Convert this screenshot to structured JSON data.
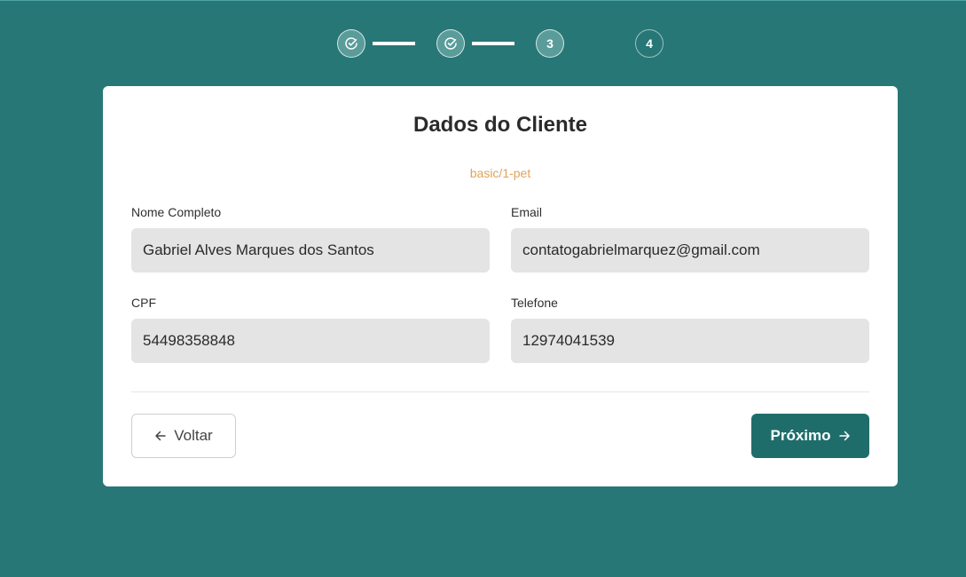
{
  "stepper": {
    "steps": [
      {
        "label": "",
        "state": "done",
        "icon": "check-circle-icon"
      },
      {
        "label": "",
        "state": "done",
        "icon": "check-circle-icon"
      },
      {
        "label": "3",
        "state": "current"
      },
      {
        "label": "4",
        "state": "upcoming"
      }
    ]
  },
  "card": {
    "title": "Dados do Cliente",
    "subtitle": "basic/1-pet"
  },
  "form": {
    "name": {
      "label": "Nome Completo",
      "value": "Gabriel Alves Marques dos Santos"
    },
    "email": {
      "label": "Email",
      "value": "contatogabrielmarquez@gmail.com"
    },
    "cpf": {
      "label": "CPF",
      "value": "54498358848"
    },
    "phone": {
      "label": "Telefone",
      "value": "12974041539"
    }
  },
  "actions": {
    "back_label": "Voltar",
    "back_icon": "arrow-left-icon",
    "next_label": "Próximo",
    "next_icon": "arrow-right-icon"
  },
  "colors": {
    "background": "#277776",
    "primary": "#1f6d6b",
    "subtitle": "#e0a35a",
    "input_bg": "#e4e4e4"
  }
}
